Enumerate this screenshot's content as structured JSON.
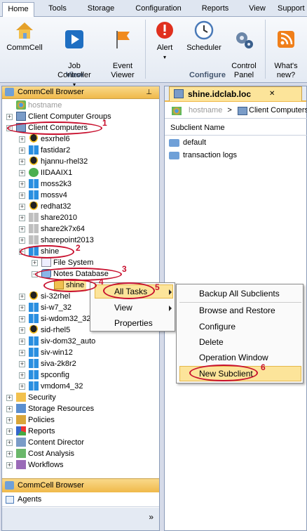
{
  "ribbon": {
    "tabs": [
      "Home",
      "Tools",
      "Storage",
      "Configuration",
      "Reports",
      "View",
      "Support"
    ],
    "buttons": {
      "commcell": "CommCell",
      "job_controller": "Job\nController",
      "event_viewer": "Event\nViewer",
      "alert": "Alert",
      "scheduler": "Scheduler",
      "control_panel": "Control\nPanel",
      "whats_new": "What's\nnew?"
    },
    "groups": {
      "view": "View",
      "configure": "Configure"
    }
  },
  "left_panel": {
    "title": "CommCell Browser",
    "pin": "⊥",
    "root_label": "hostname",
    "tree": {
      "client_computer_groups": "Client Computer Groups",
      "client_computers": "Client Computers",
      "clients": [
        "esxrhel6",
        "fastidar2",
        "hjannu-rhel32",
        "IIDAAIX1",
        "moss2k3",
        "mossv4",
        "redhat32",
        "share2010",
        "share2k7x64",
        "sharepoint2013",
        "shine"
      ],
      "file_system": "File System",
      "notes_database": "Notes Database",
      "shine_instance": "shine",
      "clients_after": [
        "si-32rhel",
        "si-w7_32",
        "si-wdom32_32",
        "sid-rhel5",
        "siv-dom32_auto",
        "siv-win12",
        "siva-2k8r2",
        "spconfig",
        "vmdom4_32"
      ],
      "top_nodes": [
        "Security",
        "Storage Resources",
        "Policies",
        "Reports",
        "Content Director",
        "Cost Analysis",
        "Workflows"
      ]
    },
    "bottom_header": "CommCell Browser",
    "bottom_item": "Agents",
    "scroll_more": "»"
  },
  "right_panel": {
    "tab_title": "shine.idclab.loc",
    "close": "✕",
    "breadcrumb_root": "hostname",
    "breadcrumb_sep": ">",
    "breadcrumb_current": "Client Computers",
    "column": "Subclient Name",
    "rows": [
      "default",
      "transaction logs"
    ]
  },
  "context_menu": {
    "items": [
      "All Tasks",
      "View",
      "Properties"
    ]
  },
  "submenu": {
    "items": [
      "Backup All Subclients",
      "Browse and Restore",
      "Configure",
      "Delete",
      "Operation Window",
      "New Subclient"
    ]
  },
  "annotations": [
    "1",
    "2",
    "3",
    "4",
    "5",
    "6"
  ],
  "colors": {
    "accent": "#f0b94a",
    "annotation": "#c8102e",
    "selection": "#fce49a"
  }
}
